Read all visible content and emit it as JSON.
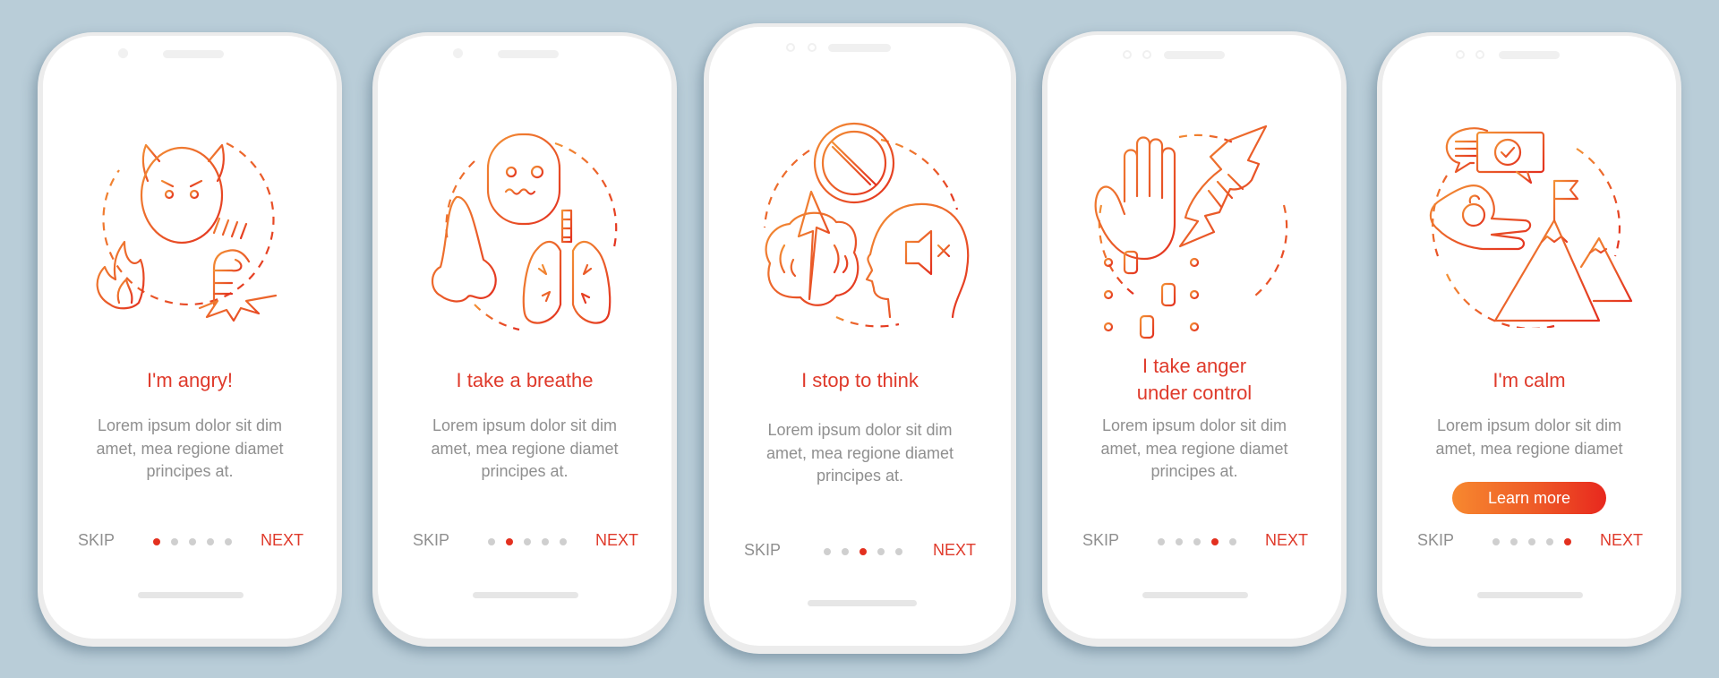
{
  "colors": {
    "background": "#b9cdd8",
    "accent_red": "#df3a2b",
    "accent_orange": "#f7882f",
    "dot_active": "#e3301f",
    "dot_inactive": "#cfcfcf",
    "body_text": "#8f8f8f"
  },
  "screens": [
    {
      "title": "I'm angry!",
      "body": [
        "Lorem ipsum dolor sit dim",
        "amet, mea regione diamet",
        "principes at."
      ],
      "skip_label": "SKIP",
      "next_label": "NEXT",
      "page_index": 1,
      "page_count": 5,
      "illustration": "angry-devil-fist-fire-icon"
    },
    {
      "title": "I take a breathe",
      "body": [
        "Lorem ipsum dolor sit dim",
        "amet, mea regione diamet",
        "principes at."
      ],
      "skip_label": "SKIP",
      "next_label": "NEXT",
      "page_index": 2,
      "page_count": 5,
      "illustration": "nose-lungs-face-icon"
    },
    {
      "title": "I stop to think",
      "body": [
        "Lorem ipsum dolor sit dim",
        "amet, mea regione diamet",
        "principes at."
      ],
      "skip_label": "SKIP",
      "next_label": "NEXT",
      "page_index": 3,
      "page_count": 5,
      "illustration": "brain-stop-mute-head-icon"
    },
    {
      "title": [
        "I take anger",
        "under control"
      ],
      "body": [
        "Lorem ipsum dolor sit dim",
        "amet, mea regione diamet",
        "principes at."
      ],
      "skip_label": "SKIP",
      "next_label": "NEXT",
      "page_index": 4,
      "page_count": 5,
      "illustration": "hand-fist-sliders-icon"
    },
    {
      "title": "I'm calm",
      "body": [
        "Lorem ipsum dolor sit dim",
        "amet, mea regione diamet"
      ],
      "button_label": "Learn more",
      "skip_label": "SKIP",
      "next_label": "NEXT",
      "page_index": 5,
      "page_count": 5,
      "illustration": "chat-meditation-mountain-icon"
    }
  ]
}
